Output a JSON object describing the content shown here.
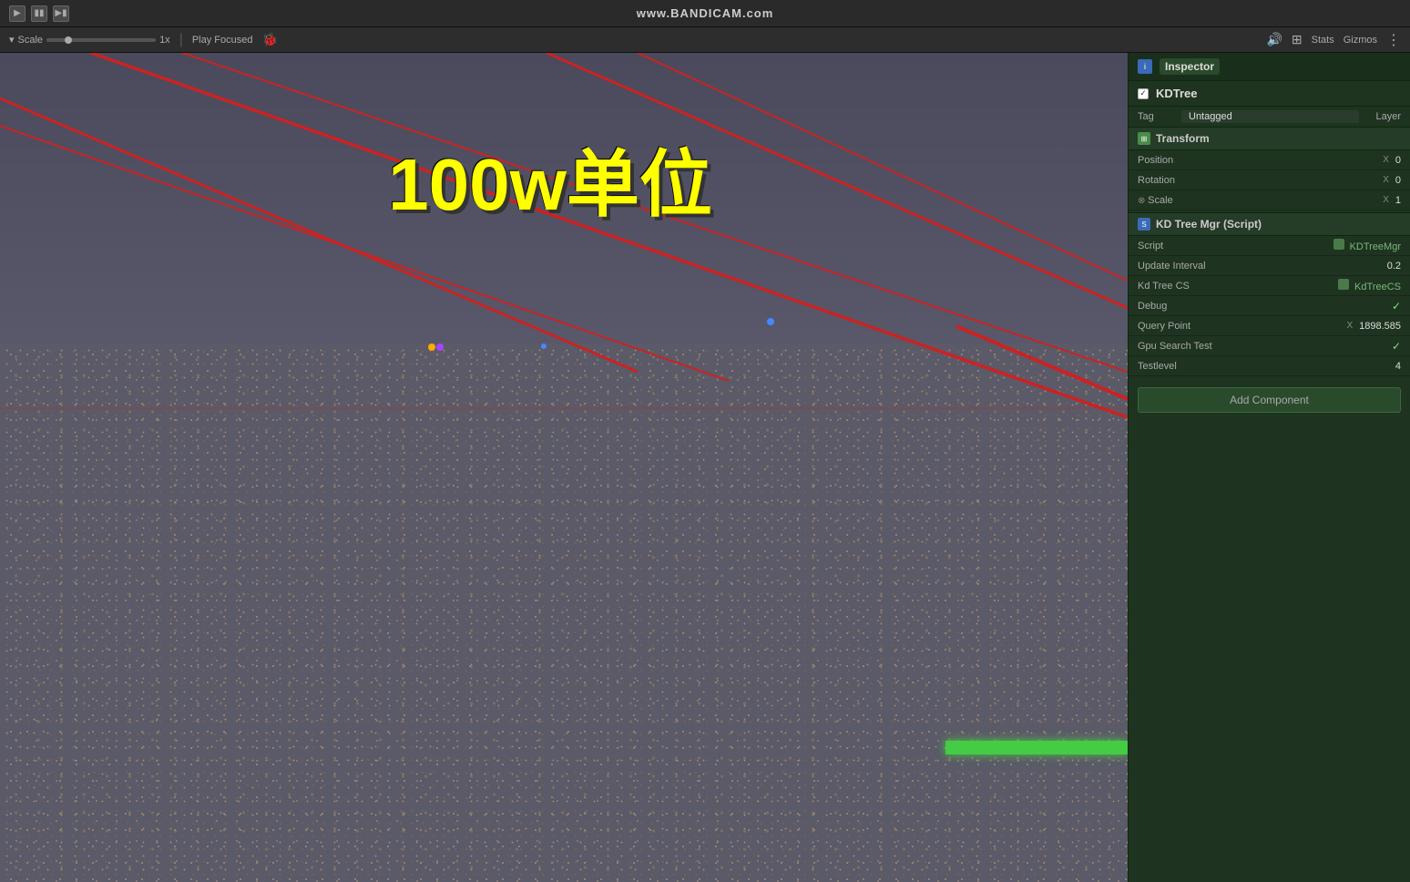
{
  "watermark": {
    "text": "www.",
    "brand": "BANDICAM",
    "suffix": ".com"
  },
  "toolbar": {
    "scale_label": "Scale",
    "scale_value": "1x",
    "play_focused_label": "Play Focused",
    "stats_label": "Stats",
    "gizmos_label": "Gizmos"
  },
  "overlay": {
    "chinese_text": "100w单位"
  },
  "inspector": {
    "tab_label": "Inspector",
    "object_name": "KDTree",
    "checkbox_checked": true,
    "tag_label": "Tag",
    "tag_value": "Untagged",
    "layer_label": "Layer",
    "transform_section": "Transform",
    "position_label": "Position",
    "position_x": "X",
    "position_value": "0",
    "rotation_label": "Rotation",
    "rotation_x": "X",
    "rotation_value": "0",
    "scale_label": "Scale",
    "scale_x": "X",
    "scale_value": "1",
    "script_section": "KD Tree Mgr (Script)",
    "script_label": "Script",
    "script_value": "KDTreeMgr",
    "update_interval_label": "Update Interval",
    "update_interval_value": "0.2",
    "kd_tree_cs_label": "Kd Tree CS",
    "kd_tree_cs_value": "KdTreeCS",
    "debug_label": "Debug",
    "debug_check": "✓",
    "query_point_label": "Query Point",
    "query_point_x": "X",
    "query_point_value": "1898.585",
    "gpu_search_test_label": "Gpu Search Test",
    "gpu_search_check": "✓",
    "testlevel_label": "Testlevel",
    "testlevel_value": "4",
    "add_component_label": "Add Component"
  }
}
